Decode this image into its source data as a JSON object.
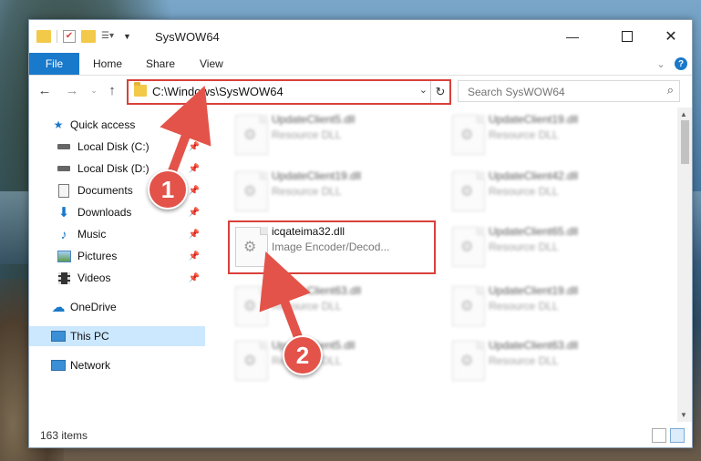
{
  "window": {
    "title": "SysWOW64"
  },
  "ribbon": {
    "tabs": [
      "File",
      "Home",
      "Share",
      "View"
    ]
  },
  "address": {
    "path": "C:\\Windows\\SysWOW64"
  },
  "search": {
    "placeholder": "Search SysWOW64"
  },
  "sidebar": {
    "items": [
      {
        "label": "Quick access",
        "icon": "star-icon",
        "pinned": false
      },
      {
        "label": "Local Disk (C:)",
        "icon": "drive-icon",
        "pinned": true
      },
      {
        "label": "Local Disk (D:)",
        "icon": "drive-icon",
        "pinned": true
      },
      {
        "label": "Documents",
        "icon": "documents-icon",
        "pinned": true
      },
      {
        "label": "Downloads",
        "icon": "download-icon",
        "pinned": true
      },
      {
        "label": "Music",
        "icon": "music-icon",
        "pinned": true
      },
      {
        "label": "Pictures",
        "icon": "pictures-icon",
        "pinned": true
      },
      {
        "label": "Videos",
        "icon": "videos-icon",
        "pinned": true
      },
      {
        "label": "OneDrive",
        "icon": "cloud-icon",
        "pinned": false
      },
      {
        "label": "This PC",
        "icon": "computer-icon",
        "pinned": false,
        "selected": true
      },
      {
        "label": "Network",
        "icon": "network-icon",
        "pinned": false
      }
    ]
  },
  "files": [
    {
      "name": "UpdateClient5.dll",
      "desc": "Resource DLL"
    },
    {
      "name": "UpdateClient19.dll",
      "desc": "Resource DLL"
    },
    {
      "name": "UpdateClient19.dll",
      "desc": "Resource DLL"
    },
    {
      "name": "UpdateClient42.dll",
      "desc": "Resource DLL"
    },
    {
      "name": "icqateima32.dll",
      "desc": "Image Encoder/Decod..."
    },
    {
      "name": "UpdateClient65.dll",
      "desc": "Resource DLL"
    },
    {
      "name": "UpdateClient63.dll",
      "desc": "Resource DLL"
    },
    {
      "name": "UpdateClient19.dll",
      "desc": "Resource DLL"
    },
    {
      "name": "UpdateClient5.dll",
      "desc": "Resource DLL"
    },
    {
      "name": "UpdateClient63.dll",
      "desc": "Resource DLL"
    }
  ],
  "status": {
    "item_count": "163 items"
  },
  "markers": {
    "one": "1",
    "two": "2"
  },
  "colors": {
    "accent": "#1979ca",
    "highlight": "#d9403a",
    "marker": "#e3534a"
  }
}
